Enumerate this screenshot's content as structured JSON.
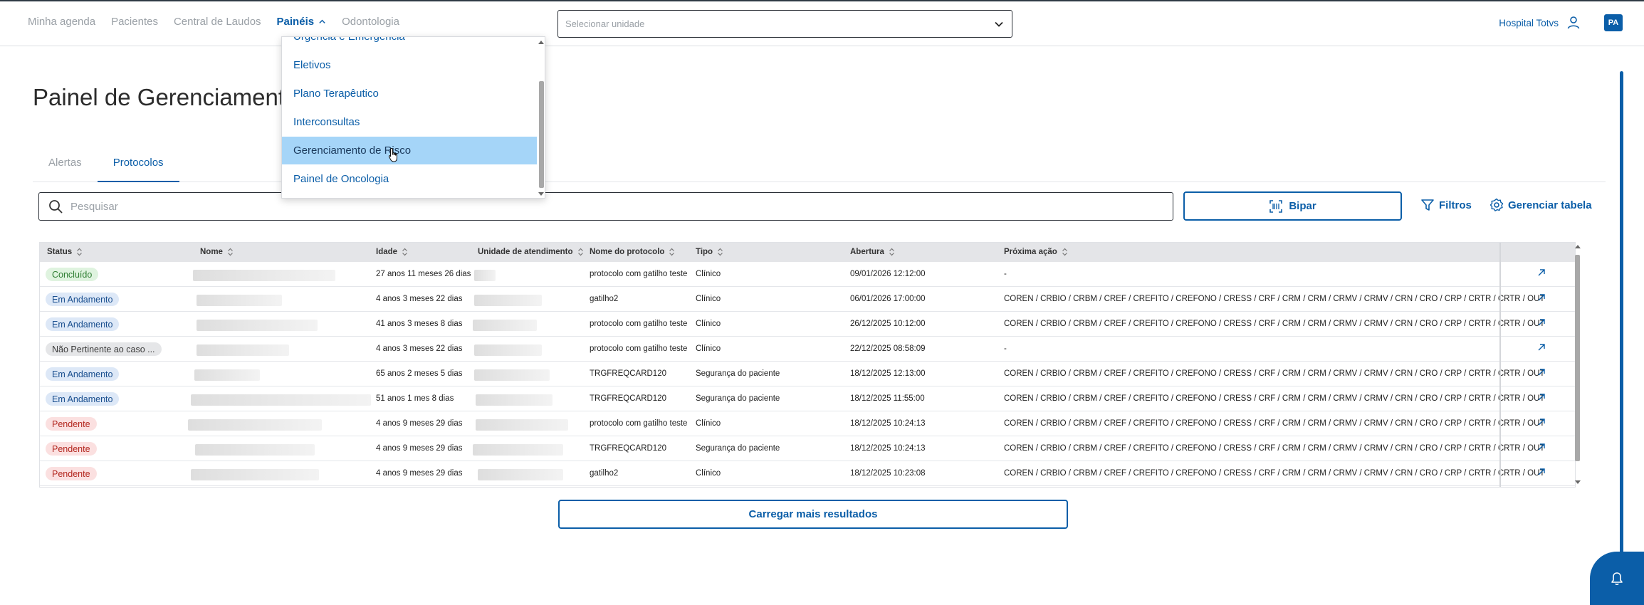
{
  "nav": {
    "items": [
      {
        "label": "Minha agenda",
        "active": false
      },
      {
        "label": "Pacientes",
        "active": false
      },
      {
        "label": "Central de Laudos",
        "active": false
      },
      {
        "label": "Painéis",
        "active": true
      },
      {
        "label": "Odontologia",
        "active": false
      }
    ]
  },
  "unit_select": {
    "placeholder": "Selecionar unidade"
  },
  "header_right": {
    "hospital": "Hospital Totvs",
    "avatar": "PA"
  },
  "page": {
    "title": "Painel de Gerenciamento d"
  },
  "tabs": [
    {
      "label": "Alertas",
      "active": false
    },
    {
      "label": "Protocolos",
      "active": true
    }
  ],
  "toolbar": {
    "search_placeholder": "Pesquisar",
    "bipar_label": "Bipar",
    "filtros_label": "Filtros",
    "gerenciar_label": "Gerenciar tabela"
  },
  "table": {
    "columns": [
      "Status",
      "Nome",
      "Idade",
      "Unidade de atendimento",
      "Nome do protocolo",
      "Tipo",
      "Abertura",
      "Próxima ação"
    ],
    "rows": [
      {
        "status": "Concluído",
        "status_color": "green",
        "idade": "27 anos 11 meses 26 dias",
        "protocolo": "protocolo com gatilho teste",
        "tipo": "Clínico",
        "abertura": "09/01/2026 12:12:00",
        "proxima": "-"
      },
      {
        "status": "Em Andamento",
        "status_color": "blue",
        "idade": "4 anos 3 meses 22 dias",
        "protocolo": "gatilho2",
        "tipo": "Clínico",
        "abertura": "06/01/2026 17:00:00",
        "proxima": "COREN / CRBIO / CRBM / CREF / CREFITO / CREFONO / CRESS / CRF / CRM / CRM / CRMV / CRMV / CRN / CRO / CRP / CRTR / CRTR / OUT"
      },
      {
        "status": "Em Andamento",
        "status_color": "blue",
        "idade": "41 anos 3 meses 8 dias",
        "protocolo": "protocolo com gatilho teste",
        "tipo": "Clínico",
        "abertura": "26/12/2025 10:12:00",
        "proxima": "COREN / CRBIO / CRBM / CREF / CREFITO / CREFONO / CRESS / CRF / CRM / CRM / CRMV / CRMV / CRN / CRO / CRP / CRTR / CRTR / OUT"
      },
      {
        "status": "Não Pertinente ao caso ...",
        "status_color": "grey",
        "idade": "4 anos 3 meses 22 dias",
        "protocolo": "protocolo com gatilho teste",
        "tipo": "Clínico",
        "abertura": "22/12/2025 08:58:09",
        "proxima": "-"
      },
      {
        "status": "Em Andamento",
        "status_color": "blue",
        "idade": "65 anos 2 meses 5 dias",
        "protocolo": "TRGFREQCARD120",
        "tipo": "Segurança do paciente",
        "abertura": "18/12/2025 12:13:00",
        "proxima": "COREN / CRBIO / CRBM / CREF / CREFITO / CREFONO / CRESS / CRF / CRM / CRM / CRMV / CRMV / CRN / CRO / CRP / CRTR / CRTR / OUT"
      },
      {
        "status": "Em Andamento",
        "status_color": "blue",
        "idade": "51 anos 1 mes 8 dias",
        "protocolo": "TRGFREQCARD120",
        "tipo": "Segurança do paciente",
        "abertura": "18/12/2025 11:55:00",
        "proxima": "COREN / CRBIO / CRBM / CREF / CREFITO / CREFONO / CRESS / CRF / CRM / CRM / CRMV / CRMV / CRN / CRO / CRP / CRTR / CRTR / OUT"
      },
      {
        "status": "Pendente",
        "status_color": "red",
        "idade": "4 anos 9 meses 29 dias",
        "protocolo": "protocolo com gatilho teste",
        "tipo": "Clínico",
        "abertura": "18/12/2025 10:24:13",
        "proxima": "COREN / CRBIO / CRBM / CREF / CREFITO / CREFONO / CRESS / CRF / CRM / CRM / CRMV / CRMV / CRN / CRO / CRP / CRTR / CRTR / OUT"
      },
      {
        "status": "Pendente",
        "status_color": "red",
        "idade": "4 anos 9 meses 29 dias",
        "protocolo": "TRGFREQCARD120",
        "tipo": "Segurança do paciente",
        "abertura": "18/12/2025 10:24:13",
        "proxima": "COREN / CRBIO / CRBM / CREF / CREFITO / CREFONO / CRESS / CRF / CRM / CRM / CRMV / CRMV / CRN / CRO / CRP / CRTR / CRTR / OUT"
      },
      {
        "status": "Pendente",
        "status_color": "red",
        "idade": "4 anos 9 meses 29 dias",
        "protocolo": "gatilho2",
        "tipo": "Clínico",
        "abertura": "18/12/2025 10:23:08",
        "proxima": "COREN / CRBIO / CRBM / CREF / CREFITO / CREFONO / CRESS / CRF / CRM / CRM / CRMV / CRMV / CRN / CRO / CRP / CRTR / CRTR / OUT"
      }
    ]
  },
  "load_more": {
    "label": "Carregar mais resultados"
  },
  "dropdown": {
    "items": [
      {
        "label": "Urgência e Emergência",
        "selected": false
      },
      {
        "label": "Eletivos",
        "selected": false
      },
      {
        "label": "Plano Terapêutico",
        "selected": false
      },
      {
        "label": "Interconsultas",
        "selected": false
      },
      {
        "label": "Gerenciamento de Risco",
        "selected": true
      },
      {
        "label": "Painel de Oncologia",
        "selected": false
      }
    ]
  },
  "colors": {
    "brand": "#0b5ea8",
    "selected_item": "#a5d5f8"
  },
  "icons": [
    "chevron-up-icon",
    "chevron-down-icon",
    "user-icon",
    "search-icon",
    "scan-icon",
    "filter-icon",
    "gear-icon",
    "sort-icon",
    "open-external-icon",
    "bell-icon"
  ]
}
